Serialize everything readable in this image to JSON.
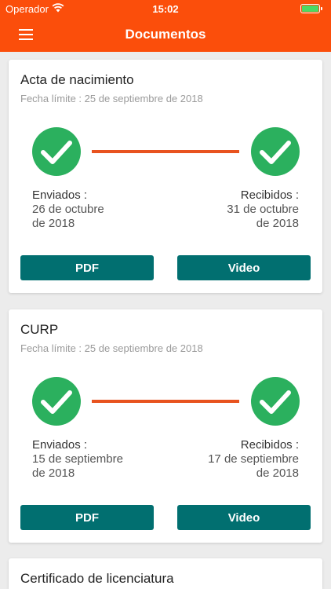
{
  "status": {
    "carrier": "Operador",
    "time": "15:02"
  },
  "nav": {
    "title": "Documentos"
  },
  "documents": [
    {
      "title": "Acta de nacimiento",
      "deadline": "Fecha límite : 25 de septiembre de 2018",
      "sent_label": "Enviados :",
      "sent_date_1": "26 de octubre",
      "sent_date_2": "de 2018",
      "received_label": "Recibidos :",
      "received_date_1": "31 de octubre",
      "received_date_2": "de 2018",
      "pdf_label": "PDF",
      "video_label": "Video"
    },
    {
      "title": "CURP",
      "deadline": "Fecha límite : 25 de septiembre de 2018",
      "sent_label": "Enviados :",
      "sent_date_1": "15 de septiembre",
      "sent_date_2": "de 2018",
      "received_label": "Recibidos :",
      "received_date_1": "17 de septiembre",
      "received_date_2": "de 2018",
      "pdf_label": "PDF",
      "video_label": "Video"
    },
    {
      "title": "Certificado de licenciatura"
    }
  ],
  "colors": {
    "header": "#fb4e0b",
    "check": "#2bb05e",
    "connector": "#e8531f",
    "button": "#016f70"
  },
  "icons": {
    "menu": "hamburger-menu-icon",
    "check": "check-circle-icon",
    "wifi": "wifi-icon",
    "battery": "battery-icon"
  }
}
